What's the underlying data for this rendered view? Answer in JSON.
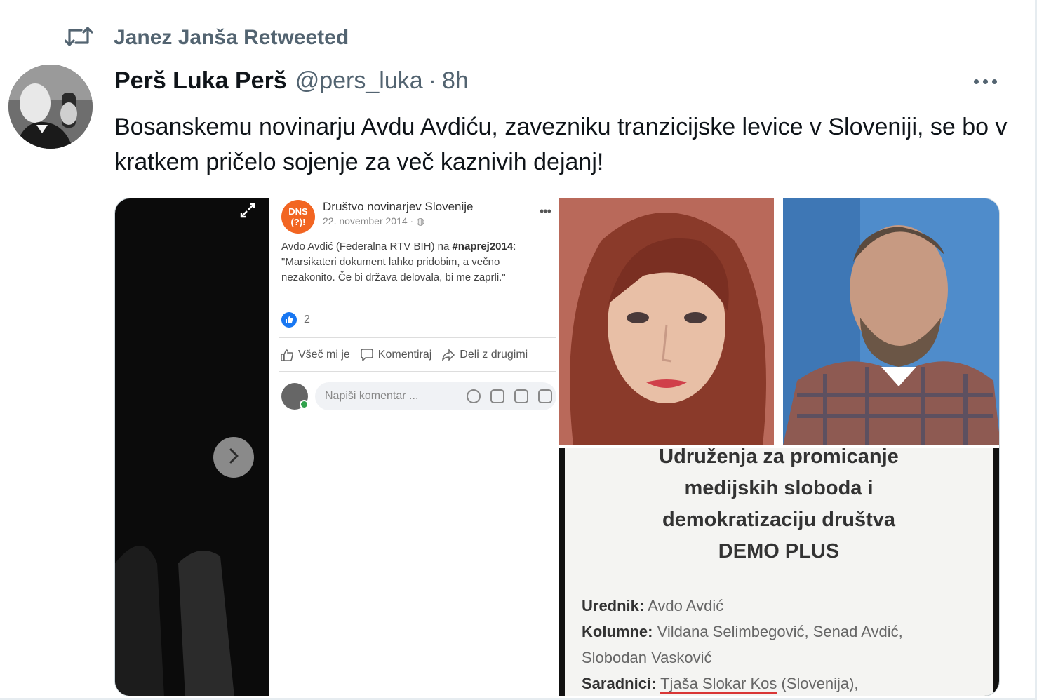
{
  "retweet": {
    "label": "Janez Janša Retweeted",
    "icon": "retweet-icon"
  },
  "tweet": {
    "display_name": "Perš Luka Perš",
    "handle": "@pers_luka",
    "separator": "·",
    "time": "8h",
    "text": "Bosanskemu novinarju Avdu Avdiću, zavezniku tranzicijske levice v Sloveniji, se bo v kratkem pričelo sojenje za več kaznivih dejanj!"
  },
  "media": {
    "facebook": {
      "page_name": "Društvo novinarjev Slovenije",
      "logo_text": "DNS\n(?)!",
      "date": "22. november 2014 · ",
      "post_line1_prefix": "Avdo Avdić (Federalna RTV BIH) na ",
      "post_hashtag": "#naprej2014",
      "post_line1_suffix": ":",
      "post_quote": "\"Marsikateri dokument lahko pridobim, a večno nezakonito. Če bi država delovala, bi me zaprli.\"",
      "like_count": "2",
      "actions": [
        "Všeč mi je",
        "Komentiraj",
        "Deli z drugimi"
      ],
      "comment_placeholder": "Napiši komentar ..."
    },
    "document": {
      "heading_lines": [
        "Udruženja za promicanje",
        "medijskih sloboda i",
        "demokratizaciju društva",
        "DEMO PLUS"
      ],
      "credits": [
        {
          "label": "Urednik:",
          "value": "Avdo Avdić"
        },
        {
          "label": "Kolumne:",
          "value": "Vildana Selimbegović, Senad Avdić,"
        },
        {
          "label": "",
          "value": "Slobodan Vasković"
        },
        {
          "label": "Saradnici:",
          "value": "Tjaša Slokar Kos",
          "suffix": " (Slovenija),"
        }
      ]
    }
  },
  "colors": {
    "text_primary": "#0f1419",
    "text_secondary": "#536471",
    "media_border": "#cfd9de",
    "dns_orange": "#f26522",
    "fb_blue": "#1877f2"
  }
}
